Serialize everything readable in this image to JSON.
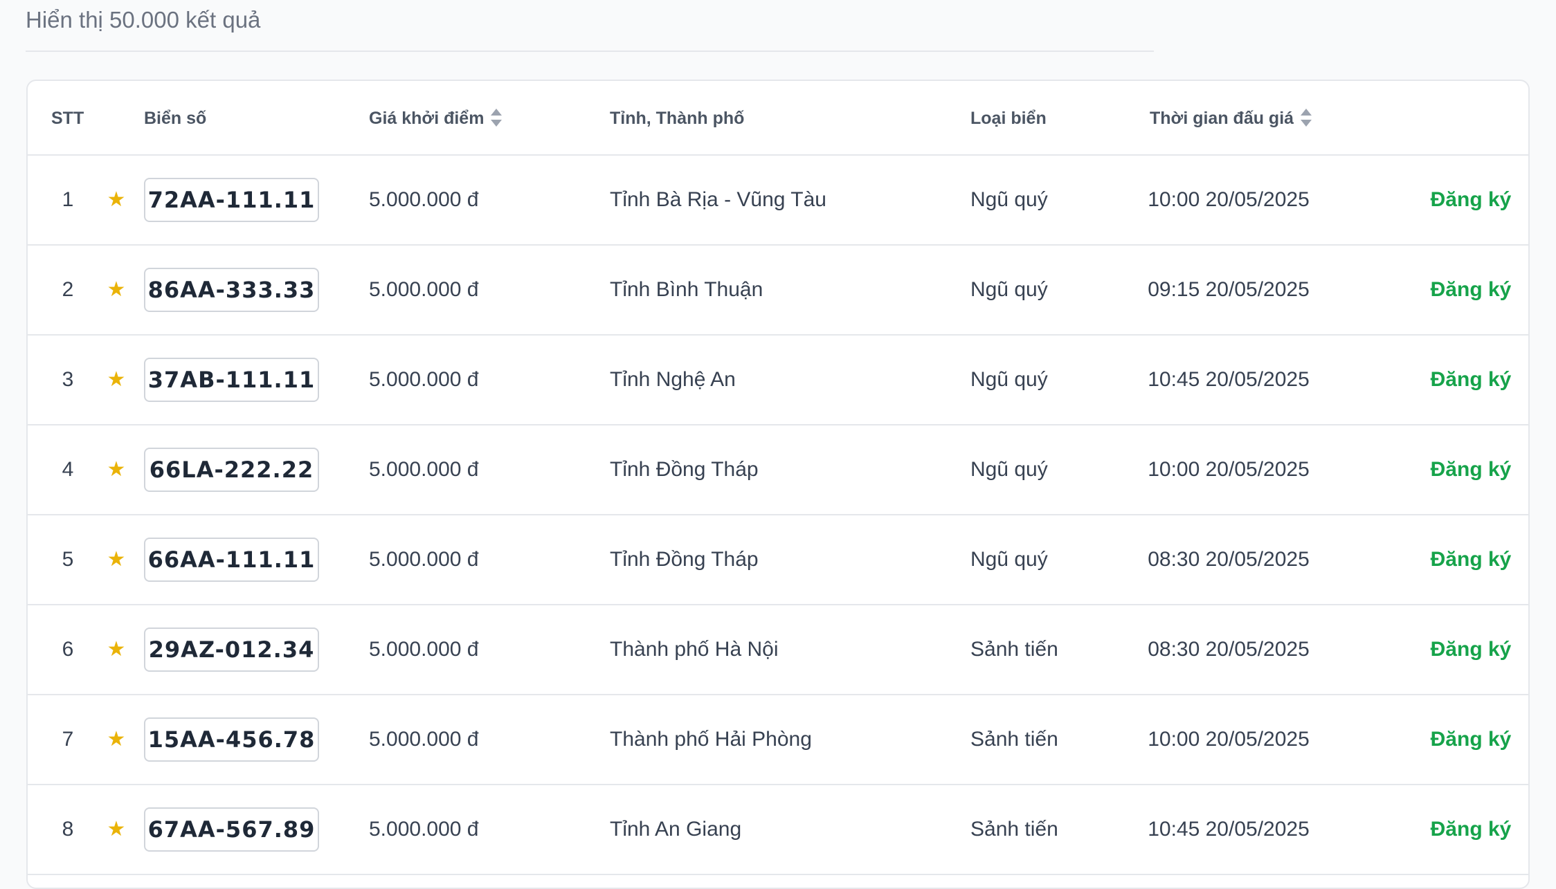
{
  "result_count": "Hiển thị 50.000 kết quả",
  "headers": {
    "stt": "STT",
    "plate": "Biển số",
    "price": "Giá khởi điểm",
    "province": "Tỉnh, Thành phố",
    "type": "Loại biển",
    "time": "Thời gian đấu giá"
  },
  "star_glyph": "★",
  "colors": {
    "accent_green": "#16a34a",
    "star": "#eab308"
  },
  "rows": [
    {
      "stt": "1",
      "plate": "72AA-111.11",
      "price": "5.000.000 đ",
      "province": "Tỉnh Bà Rịa - Vũng Tàu",
      "type": "Ngũ quý",
      "time": "10:00 20/05/2025",
      "action": "Đăng ký"
    },
    {
      "stt": "2",
      "plate": "86AA-333.33",
      "price": "5.000.000 đ",
      "province": "Tỉnh Bình Thuận",
      "type": "Ngũ quý",
      "time": "09:15 20/05/2025",
      "action": "Đăng ký"
    },
    {
      "stt": "3",
      "plate": "37AB-111.11",
      "price": "5.000.000 đ",
      "province": "Tỉnh Nghệ An",
      "type": "Ngũ quý",
      "time": "10:45 20/05/2025",
      "action": "Đăng ký"
    },
    {
      "stt": "4",
      "plate": "66LA-222.22",
      "price": "5.000.000 đ",
      "province": "Tỉnh Đồng Tháp",
      "type": "Ngũ quý",
      "time": "10:00 20/05/2025",
      "action": "Đăng ký"
    },
    {
      "stt": "5",
      "plate": "66AA-111.11",
      "price": "5.000.000 đ",
      "province": "Tỉnh Đồng Tháp",
      "type": "Ngũ quý",
      "time": "08:30 20/05/2025",
      "action": "Đăng ký"
    },
    {
      "stt": "6",
      "plate": "29AZ-012.34",
      "price": "5.000.000 đ",
      "province": "Thành phố Hà Nội",
      "type": "Sảnh tiến",
      "time": "08:30 20/05/2025",
      "action": "Đăng ký"
    },
    {
      "stt": "7",
      "plate": "15AA-456.78",
      "price": "5.000.000 đ",
      "province": "Thành phố Hải Phòng",
      "type": "Sảnh tiến",
      "time": "10:00 20/05/2025",
      "action": "Đăng ký"
    },
    {
      "stt": "8",
      "plate": "67AA-567.89",
      "price": "5.000.000 đ",
      "province": "Tỉnh An Giang",
      "type": "Sảnh tiến",
      "time": "10:45 20/05/2025",
      "action": "Đăng ký"
    }
  ]
}
